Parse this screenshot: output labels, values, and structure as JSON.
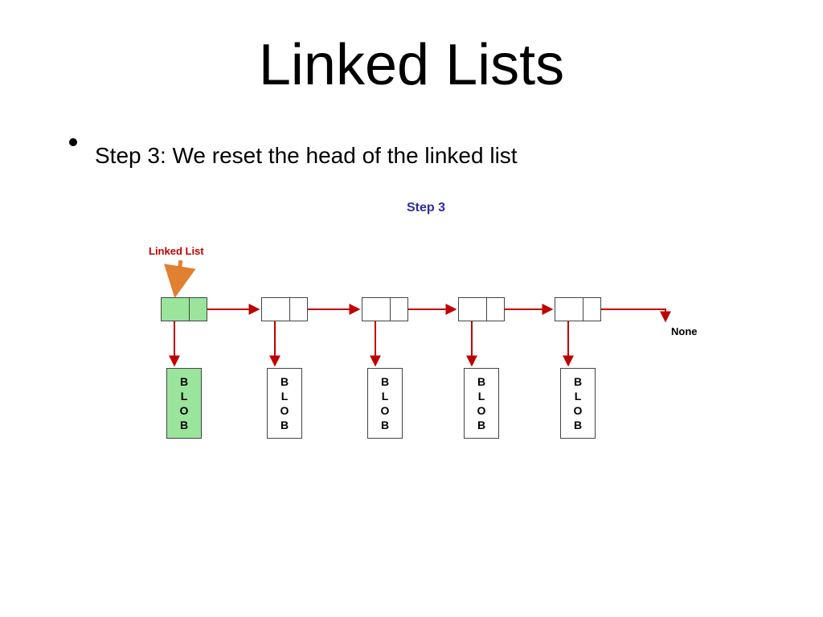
{
  "title": "Linked Lists",
  "bullet": "Step 3: We reset the head of the linked list",
  "diagram": {
    "step_label": "Step 3",
    "linked_list_label": "Linked List",
    "none_label": "None",
    "node_count": 5,
    "green_node_index": 0,
    "node_x": [
      30,
      155,
      280,
      400,
      520
    ],
    "blob_x": [
      37,
      162,
      287,
      407,
      527
    ],
    "blob_letters": [
      "B",
      "L",
      "O",
      "B"
    ]
  },
  "colors": {
    "arrow_red": "#c00000",
    "arrow_orange": "#e08030",
    "label_blue": "#2e2ea0",
    "node_green": "#9be49b"
  }
}
